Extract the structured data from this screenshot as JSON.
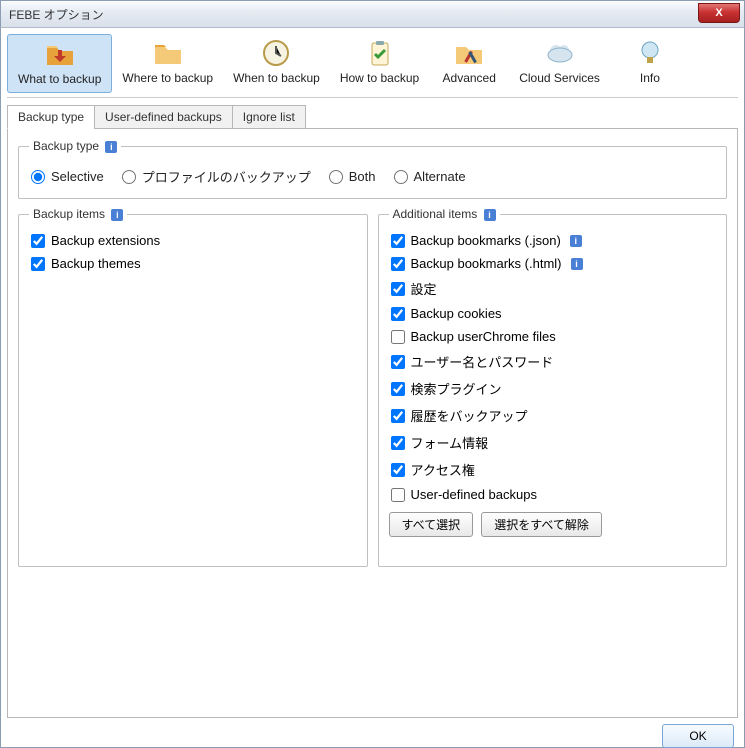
{
  "window": {
    "title": "FEBE オプション",
    "close_glyph": "X"
  },
  "toolbar": [
    {
      "label": "What to backup",
      "active": true,
      "icon": "folder-down"
    },
    {
      "label": "Where to backup",
      "active": false,
      "icon": "folder"
    },
    {
      "label": "When to backup",
      "active": false,
      "icon": "clock"
    },
    {
      "label": "How to backup",
      "active": false,
      "icon": "clipboard"
    },
    {
      "label": "Advanced",
      "active": false,
      "icon": "folder-tools"
    },
    {
      "label": "Cloud Services",
      "active": false,
      "icon": "cloud"
    },
    {
      "label": "Info",
      "active": false,
      "icon": "bulb"
    }
  ],
  "tabs": [
    {
      "label": "Backup type",
      "active": true
    },
    {
      "label": "User-defined backups",
      "active": false
    },
    {
      "label": "Ignore list",
      "active": false
    }
  ],
  "backup_type": {
    "legend": "Backup type",
    "options": [
      {
        "label": "Selective",
        "checked": true
      },
      {
        "label": "プロファイルのバックアップ",
        "checked": false
      },
      {
        "label": "Both",
        "checked": false
      },
      {
        "label": "Alternate",
        "checked": false
      }
    ]
  },
  "backup_items": {
    "legend": "Backup items",
    "items": [
      {
        "label": "Backup extensions",
        "checked": true
      },
      {
        "label": "Backup themes",
        "checked": true
      }
    ]
  },
  "additional_items": {
    "legend": "Additional items",
    "items": [
      {
        "label": "Backup bookmarks (.json)",
        "checked": true,
        "info": true
      },
      {
        "label": "Backup bookmarks (.html)",
        "checked": true,
        "info": true
      },
      {
        "label": "設定",
        "checked": true
      },
      {
        "label": "Backup cookies",
        "checked": true
      },
      {
        "label": "Backup userChrome files",
        "checked": false
      },
      {
        "label": "ユーザー名とパスワード",
        "checked": true
      },
      {
        "label": "検索プラグイン",
        "checked": true
      },
      {
        "label": "履歴をバックアップ",
        "checked": true
      },
      {
        "label": "フォーム情報",
        "checked": true
      },
      {
        "label": "アクセス権",
        "checked": true
      },
      {
        "label": "User-defined backups",
        "checked": false
      }
    ],
    "select_all": "すべて選択",
    "clear_all": "選択をすべて解除"
  },
  "footer": {
    "ok": "OK"
  }
}
